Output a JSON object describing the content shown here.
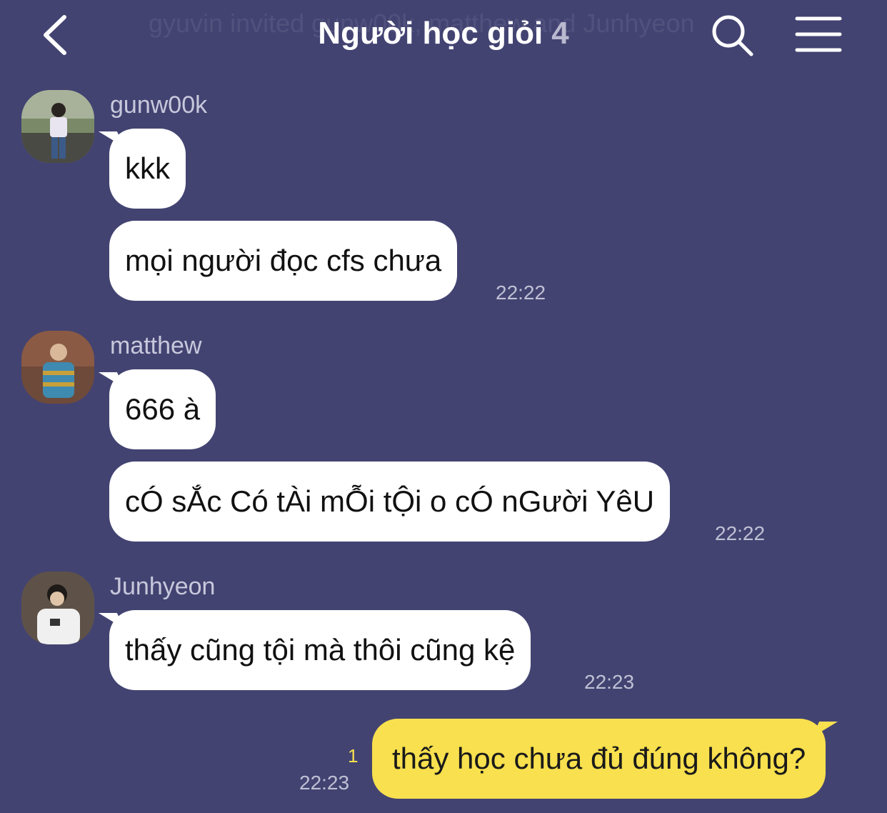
{
  "header": {
    "system_message": "gyuvin invited gunw00k, matthew and Junhyeon",
    "title": "Người học giỏi",
    "member_count": "4",
    "back_icon": "chevron-left-icon",
    "search_icon": "search-icon",
    "menu_icon": "hamburger-menu-icon"
  },
  "messages": [
    {
      "sender": "gunw00k",
      "bubbles": [
        "kkk",
        "mọi người đọc cfs chưa"
      ],
      "time": "22:22"
    },
    {
      "sender": "matthew",
      "bubbles": [
        "666 à",
        "cÓ sẮc Có tÀi mỖi tỘi o cÓ nGười YêU"
      ],
      "time": "22:22"
    },
    {
      "sender": "Junhyeon",
      "bubbles": [
        "thấy cũng tội mà thôi cũng kệ"
      ],
      "time": "22:23"
    }
  ],
  "my_message": {
    "text": "thấy học chưa đủ đúng không?",
    "time": "22:23",
    "unread_count": "1"
  },
  "colors": {
    "background": "#434372",
    "incoming_bubble": "#ffffff",
    "outgoing_bubble": "#f8e04e"
  }
}
